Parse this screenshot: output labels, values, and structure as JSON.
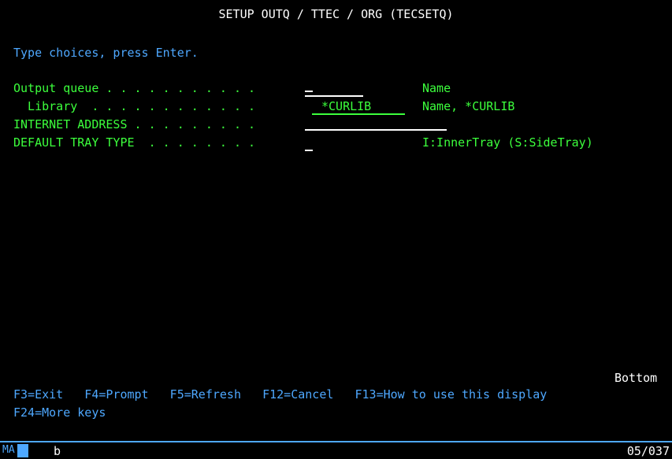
{
  "screen": {
    "title": "SETUP OUTQ / TTEC / ORG (TECSETQ)",
    "instruction": "Type choices, press Enter.",
    "fields": [
      {
        "label": "Output queue . . . . . . . . . . .",
        "value": "",
        "help": "Name"
      },
      {
        "label": "  Library  . . . . . . . . . . . .",
        "value": "*CURLIB",
        "help": "Name, *CURLIB"
      },
      {
        "label": "INTERNET ADDRESS . . . . . . . . .",
        "value": "",
        "help": ""
      },
      {
        "label": "DEFAULT TRAY TYPE  . . . . . . . .",
        "value": "",
        "help": "I:InnerTray (S:SideTray)"
      }
    ],
    "more_indicator": "Bottom",
    "function_keys_line1": "F3=Exit   F4=Prompt   F5=Refresh   F12=Cancel   F13=How to use this display",
    "function_keys_line2": "F24=More keys"
  },
  "status_bar": {
    "mode": "MA",
    "indicator": "b",
    "cursor_position": "05/037"
  },
  "colors": {
    "background": "#000000",
    "title": "#ffffff",
    "instruction": "#4ea8ff",
    "field_label": "#3cff3c",
    "field_value": "#3cff3c",
    "help_text": "#3cff3c",
    "function_keys": "#4ea8ff",
    "status_line": "#4ea8ff"
  }
}
